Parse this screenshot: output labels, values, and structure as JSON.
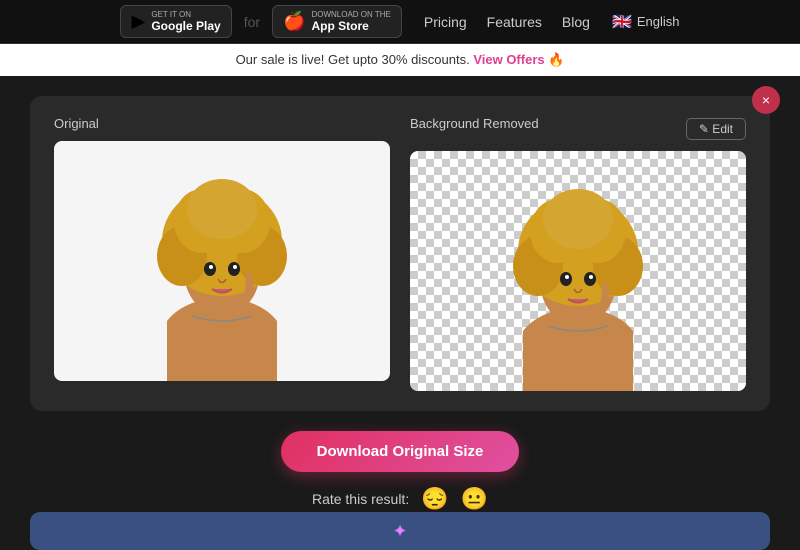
{
  "nav": {
    "google_play": {
      "get_it": "GET IT ON",
      "store_name": "Google Play"
    },
    "app_store": {
      "download_on": "Download on the",
      "store_name": "App Store"
    },
    "divider": "for",
    "links": [
      {
        "label": "Pricing",
        "name": "pricing-link"
      },
      {
        "label": "Features",
        "name": "features-link"
      },
      {
        "label": "Blog",
        "name": "blog-link"
      }
    ],
    "language": "English",
    "flag": "🇬🇧"
  },
  "banner": {
    "text": "Our sale is live! Get upto 30% discounts.",
    "link_text": "View Offers",
    "emoji": "🔥"
  },
  "main": {
    "close_btn_label": "×",
    "original_label": "Original",
    "background_removed_label": "Background Removed",
    "edit_btn_label": "✎ Edit",
    "download_btn_label": "Download Original Size",
    "rating_label": "Rate this result:",
    "rating_emojis": [
      "😔",
      "😐"
    ]
  },
  "bottom_bar": {
    "sparkle": "✦"
  }
}
